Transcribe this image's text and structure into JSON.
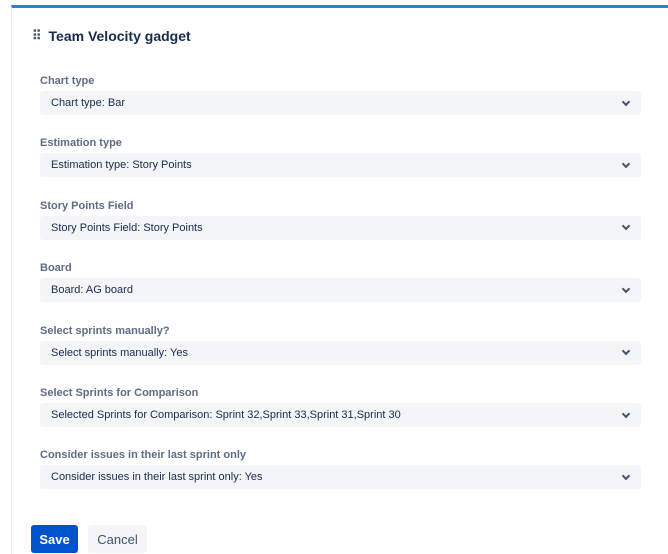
{
  "title": "Team Velocity gadget",
  "fields": [
    {
      "label": "Chart type",
      "value": "Chart type: Bar"
    },
    {
      "label": "Estimation type",
      "value": "Estimation type: Story Points"
    },
    {
      "label": "Story Points Field",
      "value": "Story Points Field: Story Points"
    },
    {
      "label": "Board",
      "value": "Board: AG board"
    },
    {
      "label": "Select sprints manually?",
      "value": "Select sprints manually: Yes"
    },
    {
      "label": "Select Sprints for Comparison",
      "value": "Selected Sprints for Comparison: Sprint 32,Sprint 33,Sprint 31,Sprint 30"
    },
    {
      "label": "Consider issues in their last sprint only",
      "value": "Consider issues in their last sprint only: Yes"
    }
  ],
  "buttons": {
    "save": "Save",
    "cancel": "Cancel"
  }
}
